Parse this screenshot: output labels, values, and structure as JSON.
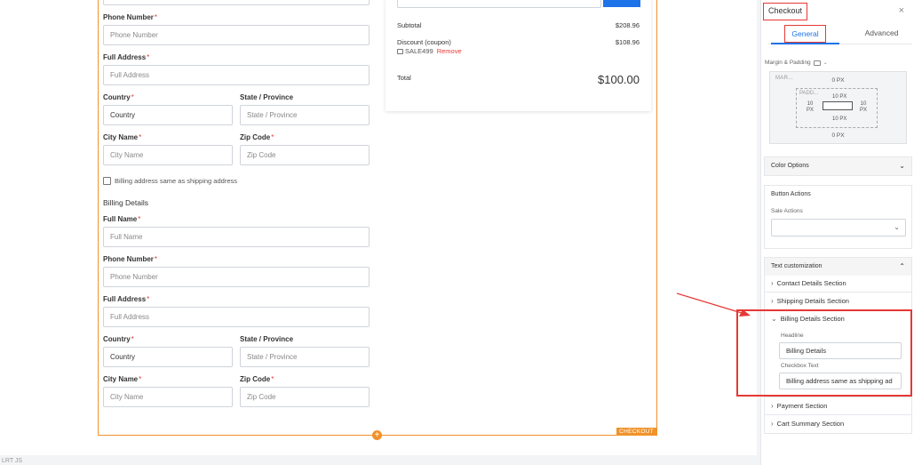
{
  "form": {
    "phone_label": "Phone Number",
    "phone_placeholder": "Phone Number",
    "address_label": "Full Address",
    "address_placeholder": "Full Address",
    "country_label": "Country",
    "country_value": "Country",
    "state_label": "State / Province",
    "state_placeholder": "State / Province",
    "city_label": "City Name",
    "city_placeholder": "City Name",
    "zip_label": "Zip Code",
    "zip_placeholder": "Zip Code",
    "same_as_shipping": "Billing address same as shipping address",
    "billing_title": "Billing Details",
    "full_name_label": "Full Name",
    "full_name_placeholder": "Full Name",
    "required_mark": "*"
  },
  "summary": {
    "subtotal_label": "Subtotal",
    "subtotal_value": "$208.96",
    "discount_label": "Discount (coupon)",
    "discount_value": "$108.96",
    "coupon_code": "SALE499",
    "remove_label": "Remove",
    "total_label": "Total",
    "total_value": "$100.00"
  },
  "frame": {
    "tag": "CHECKOUT",
    "plus": "+"
  },
  "footer_text": "LRT JS",
  "panel": {
    "title": "Checkout",
    "close": "×",
    "tabs": [
      "General",
      "Advanced"
    ],
    "margin_padding_label": "Margin & Padding",
    "box_model": {
      "margin_label": "MAR...",
      "margin_top": "0 PX",
      "margin_bottom": "0 PX",
      "padding_label": "PADD...",
      "padding_top": "10 PX",
      "padding_left_value": "10",
      "padding_left_unit": "PX",
      "padding_right_value": "10",
      "padding_right_unit": "PX",
      "padding_bottom": "10 PX"
    },
    "color_options": "Color Options",
    "button_actions": "Button Actions",
    "sale_actions_label": "Sale Actions",
    "text_customization": "Text customization",
    "sections": {
      "contact": "Contact Details Section",
      "shipping": "Shipping Details Section",
      "billing": "Billing Details Section",
      "payment": "Payment Section",
      "cart": "Cart Summary Section"
    },
    "billing_fields": {
      "headline_label": "Headline",
      "headline_value": "Billing Details",
      "checkbox_label": "Checkbox Text",
      "checkbox_value": "Billing address same as shipping ad"
    }
  },
  "colors": {
    "accent": "#1e73e8",
    "frame": "#f0932b",
    "highlight": "#e53935"
  }
}
